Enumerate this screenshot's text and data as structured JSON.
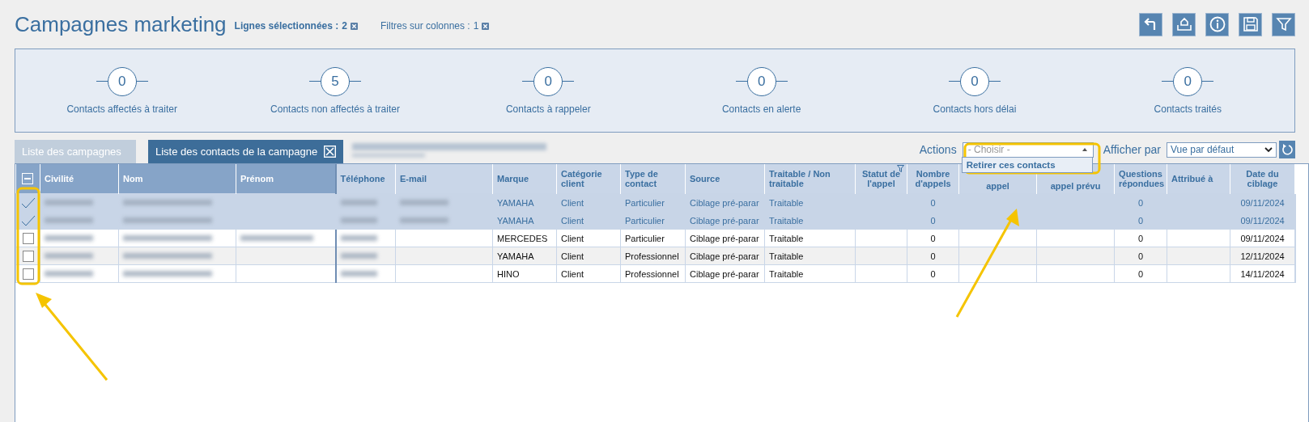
{
  "header": {
    "title": "Campagnes marketing",
    "filters": [
      {
        "label": "Lignes sélectionnées :",
        "count": "2",
        "emphasized": true
      },
      {
        "label": "Filtres sur colonnes :",
        "count": "1",
        "emphasized": false
      }
    ]
  },
  "stats": [
    {
      "value": "0",
      "label": "Contacts affectés à traiter"
    },
    {
      "value": "5",
      "label": "Contacts non affectés à traiter"
    },
    {
      "value": "0",
      "label": "Contacts à rappeler"
    },
    {
      "value": "0",
      "label": "Contacts en alerte"
    },
    {
      "value": "0",
      "label": "Contacts hors délai"
    },
    {
      "value": "0",
      "label": "Contacts traités"
    }
  ],
  "tabs": [
    {
      "kind": "tab",
      "label": "Liste des campagnes",
      "selected": false,
      "closable": false
    },
    {
      "kind": "tab",
      "label": "Liste des contacts de la campagne",
      "selected": true,
      "closable": true
    },
    {
      "kind": "redacted"
    }
  ],
  "toolbar": {
    "actions_label": "Actions",
    "actions_select": {
      "placeholder": "- Choisir -",
      "expanded": true,
      "options": [
        "Retirer ces contacts"
      ]
    },
    "view_label": "Afficher par",
    "view_select": {
      "value": "Vue par défaut"
    }
  },
  "table": {
    "select_all_partial": true,
    "columns": [
      {
        "label": "Civilité",
        "frozen": true,
        "filter": false
      },
      {
        "label": "Nom",
        "frozen": true,
        "filter": false
      },
      {
        "label": "Prénom",
        "frozen": true,
        "filter": false
      },
      {
        "label": "Téléphone",
        "frozen": false,
        "filter": false
      },
      {
        "label": "E-mail",
        "frozen": false,
        "filter": false
      },
      {
        "label": "Marque",
        "frozen": false,
        "filter": false
      },
      {
        "label": "Catégorie client",
        "frozen": false,
        "filter": false
      },
      {
        "label": "Type de contact",
        "frozen": false,
        "filter": false
      },
      {
        "label": "Source",
        "frozen": false,
        "filter": false
      },
      {
        "label": "Traitable / Non traitable",
        "frozen": false,
        "filter": false
      },
      {
        "label": "Statut de l'appel",
        "frozen": false,
        "filter": true
      },
      {
        "label": "Nombre d'appels",
        "frozen": false,
        "filter": false
      },
      {
        "label": "appel",
        "frozen": false,
        "filter": false
      },
      {
        "label": "appel prévu",
        "frozen": false,
        "filter": false
      },
      {
        "label": "Questions répondues",
        "frozen": false,
        "filter": false
      },
      {
        "label": "Attribué à",
        "frozen": false,
        "filter": false
      },
      {
        "label": "Date du ciblage",
        "frozen": false,
        "filter": false
      }
    ],
    "rows": [
      {
        "selected": true,
        "cells": [
          {
            "redacted": true
          },
          {
            "redacted": true
          },
          null,
          {
            "redacted": true
          },
          {
            "redacted": true
          },
          "YAMAHA",
          "Client",
          "Particulier",
          "Ciblage pré-parar",
          "Traitable",
          null,
          "0",
          null,
          null,
          "0",
          null,
          "09/11/2024"
        ]
      },
      {
        "selected": true,
        "cells": [
          {
            "redacted": true
          },
          {
            "redacted": true
          },
          null,
          {
            "redacted": true
          },
          {
            "redacted": true
          },
          "YAMAHA",
          "Client",
          "Particulier",
          "Ciblage pré-parar",
          "Traitable",
          null,
          "0",
          null,
          null,
          "0",
          null,
          "09/11/2024"
        ]
      },
      {
        "selected": false,
        "cells": [
          {
            "redacted": true
          },
          {
            "redacted": true
          },
          {
            "redacted": true
          },
          {
            "redacted": true
          },
          null,
          "MERCEDES",
          "Client",
          "Particulier",
          "Ciblage pré-parar",
          "Traitable",
          null,
          "0",
          null,
          null,
          "0",
          null,
          "09/11/2024"
        ]
      },
      {
        "selected": false,
        "cells": [
          {
            "redacted": true
          },
          {
            "redacted": true
          },
          null,
          {
            "redacted": true
          },
          null,
          "YAMAHA",
          "Client",
          "Professionnel",
          "Ciblage pré-parar",
          "Traitable",
          null,
          "0",
          null,
          null,
          "0",
          null,
          "12/11/2024"
        ]
      },
      {
        "selected": false,
        "cells": [
          {
            "redacted": true
          },
          {
            "redacted": true
          },
          null,
          {
            "redacted": true
          },
          null,
          "HINO",
          "Client",
          "Professionnel",
          "Ciblage pré-parar",
          "Traitable",
          null,
          "0",
          null,
          null,
          "0",
          null,
          "14/11/2024"
        ]
      }
    ]
  }
}
